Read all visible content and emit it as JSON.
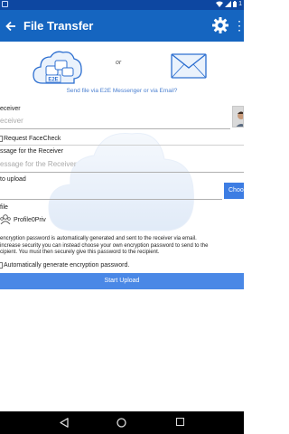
{
  "app": {
    "title": "File Transfer",
    "more_glyph": "⋮",
    "status_time": "1"
  },
  "methods": {
    "e2e_badge": "E2E",
    "or_label": "or",
    "hint": "Send file via E2E Messenger or via Email?"
  },
  "form": {
    "receiver_label": "eceiver",
    "receiver_placeholder": "eceiver",
    "facecheck_label": "Request FaceCheck",
    "message_label": "ssage for the Receiver",
    "message_placeholder": "essage for the Receiver",
    "file_upload_label": "to upload",
    "choose_button": "Choo",
    "file_label": "file",
    "profile_file_name": "Profile0Priv"
  },
  "info": {
    "lines": [
      "encryption password is automatically generated and sent to the receiver via email.",
      "increase security you can instead choose your own encryption password to send to the",
      "cipient. You must then securely give this password to the recipient."
    ]
  },
  "autogen": {
    "label": "Automatically generate encryption password."
  },
  "actions": {
    "start_upload": "Start Upload"
  },
  "colors": {
    "status_bar": "#0d47a1",
    "app_bar": "#1565c0",
    "accent": "#4a88e6",
    "hint_text": "#4a7fd0"
  },
  "icons": [
    "back-arrow-icon",
    "gear-icon",
    "more-icon",
    "e2e-cloud-icon",
    "email-envelope-icon",
    "user-avatar-icon",
    "profile-icon",
    "nav-back-icon",
    "nav-home-icon",
    "nav-recent-icon"
  ]
}
